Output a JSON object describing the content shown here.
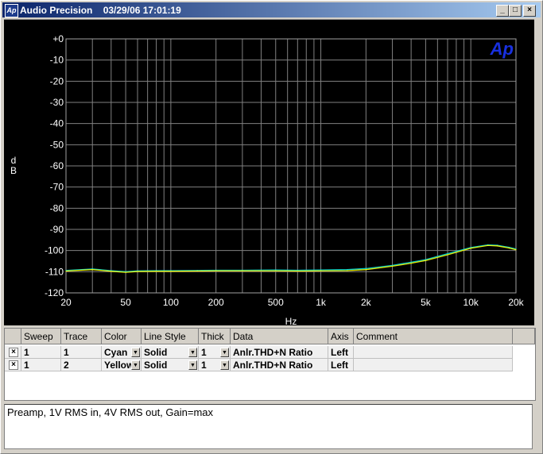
{
  "window": {
    "app_name": "Audio Precision",
    "timestamp": "03/29/06 17:01:19",
    "minimize_label": "_",
    "maximize_label": "□",
    "close_label": "×",
    "app_icon_text": "Ap"
  },
  "chart_data": {
    "type": "line",
    "logo": "Ap",
    "xlabel": "Hz",
    "ylabel": "d\nB",
    "x_scale": "log",
    "xlim": [
      20,
      20000
    ],
    "ylim": [
      -120,
      0
    ],
    "grid": true,
    "x_tick_labels": [
      "20",
      "50",
      "100",
      "200",
      "500",
      "1k",
      "2k",
      "5k",
      "10k",
      "20k"
    ],
    "y_tick_labels": [
      "+0",
      "-10",
      "-20",
      "-30",
      "-40",
      "-50",
      "-60",
      "-70",
      "-80",
      "-90",
      "-100",
      "-110",
      "-120"
    ],
    "series": [
      {
        "color": "#00e0e0",
        "x": [
          20,
          30,
          40,
          50,
          60,
          80,
          100,
          150,
          200,
          300,
          500,
          700,
          1000,
          1500,
          2000,
          3000,
          4000,
          5000,
          7000,
          10000,
          13000,
          15000,
          18000,
          20000
        ],
        "y": [
          -109.4,
          -108.7,
          -109.5,
          -110,
          -109.6,
          -109.5,
          -109.5,
          -109.4,
          -109.3,
          -109.3,
          -109.2,
          -109.3,
          -109.2,
          -109,
          -108.5,
          -107,
          -105.5,
          -104.3,
          -101.5,
          -98.6,
          -97.3,
          -97.5,
          -98.5,
          -99.3
        ]
      },
      {
        "color": "#ffff00",
        "x": [
          20,
          30,
          40,
          50,
          60,
          80,
          100,
          150,
          200,
          300,
          500,
          700,
          1000,
          1500,
          2000,
          3000,
          4000,
          5000,
          7000,
          10000,
          13000,
          15000,
          18000,
          20000
        ],
        "y": [
          -109.7,
          -109,
          -109.8,
          -110.3,
          -109.9,
          -109.8,
          -109.8,
          -109.7,
          -109.6,
          -109.6,
          -109.6,
          -109.7,
          -109.6,
          -109.5,
          -109,
          -107.4,
          -106,
          -104.7,
          -102,
          -98.9,
          -97.6,
          -97.8,
          -98.8,
          -99.6
        ]
      }
    ]
  },
  "grid_table": {
    "headers": [
      "Sweep",
      "Trace",
      "Color",
      "Line Style",
      "Thick",
      "Data",
      "Axis",
      "Comment"
    ],
    "rows": [
      {
        "checked": "×",
        "sweep": "1",
        "trace": "1",
        "color": "Cyan",
        "line_style": "Solid",
        "thick": "1",
        "data": "Anlr.THD+N Ratio",
        "axis": "Left",
        "comment": ""
      },
      {
        "checked": "×",
        "sweep": "1",
        "trace": "2",
        "color": "Yellow",
        "line_style": "Solid",
        "thick": "1",
        "data": "Anlr.THD+N Ratio",
        "axis": "Left",
        "comment": ""
      }
    ],
    "dropdown_glyph": "▼"
  },
  "comment_text": "Preamp, 1V RMS in, 4V RMS out, Gain=max"
}
